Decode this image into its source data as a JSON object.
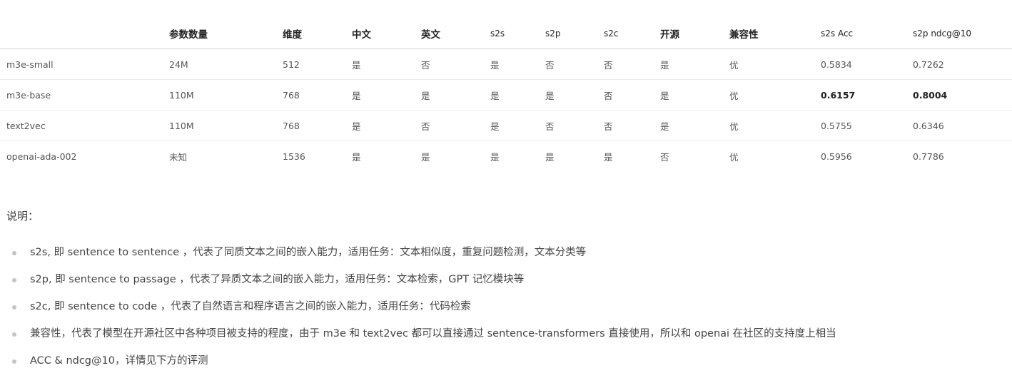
{
  "table": {
    "headers": [
      "",
      "参数数量",
      "维度",
      "中文",
      "英文",
      "s2s",
      "s2p",
      "s2c",
      "开源",
      "兼容性",
      "s2s Acc",
      "s2p ndcg@10"
    ],
    "rows": [
      [
        "m3e-small",
        "24M",
        "512",
        "是",
        "否",
        "是",
        "否",
        "否",
        "是",
        "优",
        "0.5834",
        "0.7262"
      ],
      [
        "m3e-base",
        "110M",
        "768",
        "是",
        "是",
        "是",
        "是",
        "否",
        "是",
        "优",
        "0.6157",
        "0.8004"
      ],
      [
        "text2vec",
        "110M",
        "768",
        "是",
        "否",
        "是",
        "否",
        "否",
        "是",
        "优",
        "0.5755",
        "0.6346"
      ],
      [
        "openai-ada-002",
        "未知",
        "1536",
        "是",
        "是",
        "是",
        "是",
        "是",
        "否",
        "优",
        "0.5956",
        "0.7786"
      ]
    ]
  },
  "notes": {
    "title": "说明：",
    "items": [
      "s2s, 即 sentence to sentence ，代表了同质文本之间的嵌入能力，适用任务：文本相似度，重复问题检测，文本分类等",
      "s2p, 即 sentence to passage ，代表了异质文本之间的嵌入能力，适用任务：文本检索，GPT 记忆模块等",
      "s2c, 即 sentence to code ，代表了自然语言和程序语言之间的嵌入能力，适用任务：代码检索",
      "兼容性，代表了模型在开源社区中各种项目被支持的程度，由于 m3e 和 text2vec 都可以直接通过 sentence-transformers 直接使用，所以和 openai 在社区的支持度上相当",
      "ACC & ndcg@10，详情见下方的评测"
    ]
  }
}
